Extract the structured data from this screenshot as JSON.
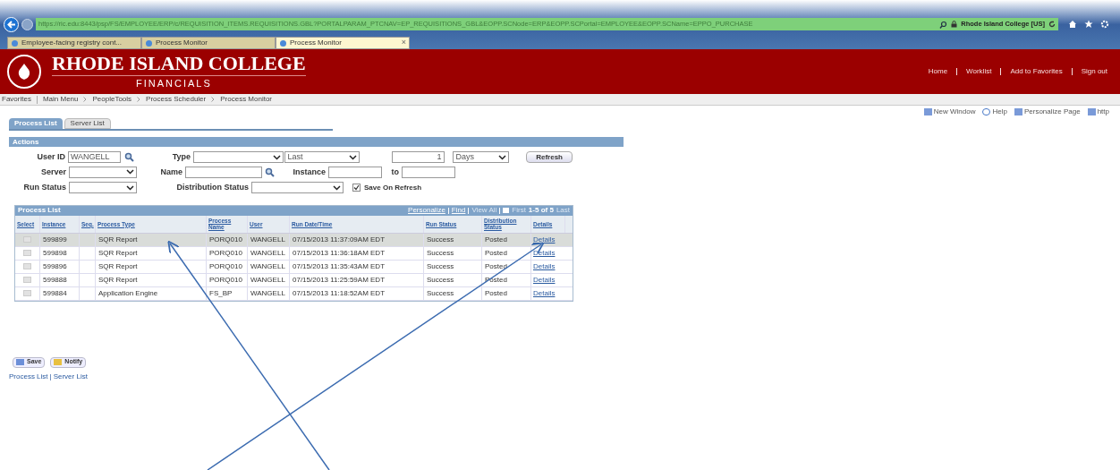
{
  "browser": {
    "address": "https://ric.edu:8443/psp/FS/EMPLOYEE/ERP/c/REQUISITION_ITEMS.REQUISITIONS.GBL?PORTALPARAM_PTCNAV=EP_REQUISITIONS_GBL&EOPP.SCNode=ERP&EOPP.SCPortal=EMPLOYEE&EOPP.SCName=EPPO_PURCHASE",
    "site": "Rhode Island College [US]",
    "tabs": [
      {
        "label": "Employee-facing registry cont...",
        "selected": false
      },
      {
        "label": "Process Monitor",
        "selected": false
      },
      {
        "label": "Process Monitor",
        "selected": true,
        "close": "×"
      }
    ]
  },
  "header": {
    "title": "RHODE ISLAND COLLEGE",
    "subtitle": "FINANCIALS",
    "links": [
      "Home",
      "Worklist",
      "Add to Favorites",
      "Sign out"
    ]
  },
  "breadcrumbs": [
    "Favorites",
    "Main Menu",
    "PeopleTools",
    "Process Scheduler",
    "Process Monitor"
  ],
  "page_links": [
    "New Window",
    "Help",
    "Personalize Page",
    "http"
  ],
  "page_tabs": [
    {
      "label": "Process List",
      "selected": true
    },
    {
      "label": "Server List",
      "selected": false
    }
  ],
  "actions": {
    "title": "Actions",
    "user_id_label": "User ID",
    "user_id": "WANGELL",
    "type_label": "Type",
    "last": "Last",
    "count": "1",
    "unit": "Days",
    "refresh": "Refresh",
    "server_label": "Server",
    "name_label": "Name",
    "instance_label": "Instance",
    "to_label": "to",
    "run_status_label": "Run Status",
    "distribution_status_label": "Distribution Status",
    "save_on_refresh": {
      "label": "Save On Refresh",
      "checked": true
    }
  },
  "grid": {
    "title": "Process List",
    "nav": [
      "Personalize",
      "Find",
      "View All",
      "First",
      "1-5 of 5",
      "Last"
    ],
    "columns": [
      "Select",
      "Instance",
      "Seq.",
      "Process Type",
      "Process Name",
      "User",
      "Run Date/Time",
      "Run Status",
      "Distribution Status",
      "Details"
    ],
    "rows": [
      {
        "selected": true,
        "instance": "599899",
        "process_type": "SQR Report",
        "process_name": "PORQ010",
        "user": "WANGELL",
        "run_date": "07/15/2013 11:37:09AM EDT",
        "run_status": "Success",
        "distribution_status": "Posted",
        "details": "Details"
      },
      {
        "selected": false,
        "instance": "599898",
        "process_type": "SQR Report",
        "process_name": "PORQ010",
        "user": "WANGELL",
        "run_date": "07/15/2013 11:36:18AM EDT",
        "run_status": "Success",
        "distribution_status": "Posted",
        "details": "Details"
      },
      {
        "selected": false,
        "instance": "599896",
        "process_type": "SQR Report",
        "process_name": "PORQ010",
        "user": "WANGELL",
        "run_date": "07/15/2013 11:35:43AM EDT",
        "run_status": "Success",
        "distribution_status": "Posted",
        "details": "Details"
      },
      {
        "selected": false,
        "instance": "599888",
        "process_type": "SQR Report",
        "process_name": "PORQ010",
        "user": "WANGELL",
        "run_date": "07/15/2013 11:25:59AM EDT",
        "run_status": "Success",
        "distribution_status": "Posted",
        "details": "Details"
      },
      {
        "selected": false,
        "instance": "599884",
        "process_type": "Application Engine",
        "process_name": "FS_BP",
        "user": "WANGELL",
        "run_date": "07/15/2013 11:18:52AM EDT",
        "run_status": "Success",
        "distribution_status": "Posted",
        "details": "Details"
      }
    ]
  },
  "buttons": [
    "Save",
    "Notify"
  ],
  "footer_links": [
    "Process List",
    "Server List"
  ],
  "footer_separator": "|"
}
